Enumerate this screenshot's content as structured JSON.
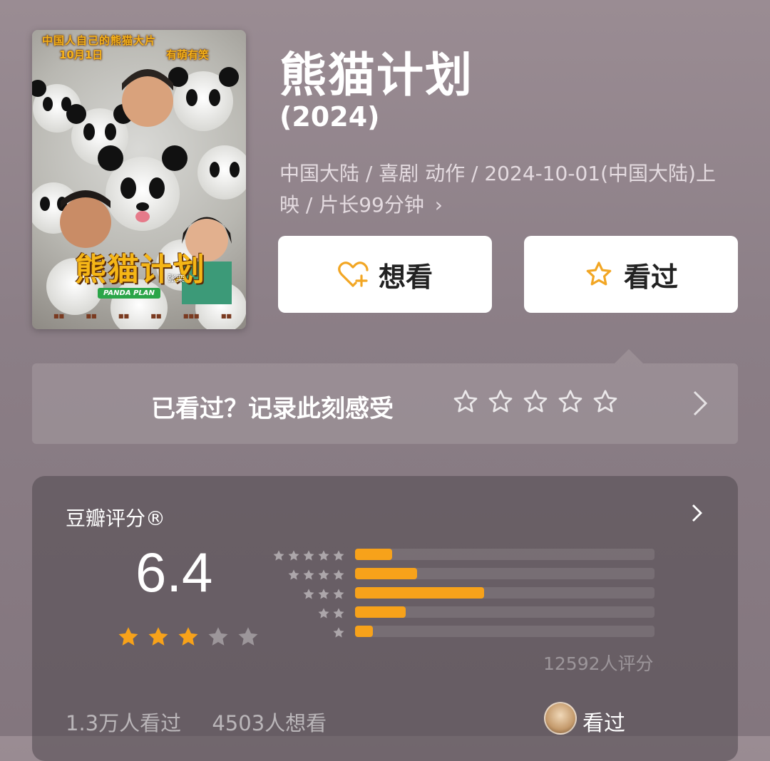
{
  "poster": {
    "tagline_top": "中国人自己的熊猫大片",
    "tagline_date": "10月1日",
    "tagline_right": "有萌有笑",
    "logo_text": "熊猫计划",
    "director": "张栾",
    "english_title": "PANDA PLAN"
  },
  "movie": {
    "title": "熊猫计划",
    "year": "(2024)",
    "meta": "中国大陆 / 喜剧 动作 / 2024-10-01(中国大陆)上映 / 片长99分钟",
    "meta_chevron": "›"
  },
  "actions": {
    "want_label": "想看",
    "want_icon": "heart-plus-icon",
    "seen_label": "看过",
    "seen_icon": "star-outline-icon",
    "accent": "#f2a623"
  },
  "record": {
    "prompt": "已看过？记录此刻感受",
    "star_count": 5
  },
  "rating": {
    "label": "豆瓣评分®",
    "score": "6.4",
    "stars": 3,
    "max_stars": 5,
    "distribution_percent": [
      12.4,
      20.7,
      43.1,
      16.9,
      5.9
    ],
    "rating_count": "12592人评分",
    "seen_count": "1.3万人看过",
    "want_count": "4503人想看",
    "seen_label": "看过"
  },
  "colors": {
    "bar_fill": "#f7a21a",
    "star_fill": "#f7a21a"
  }
}
